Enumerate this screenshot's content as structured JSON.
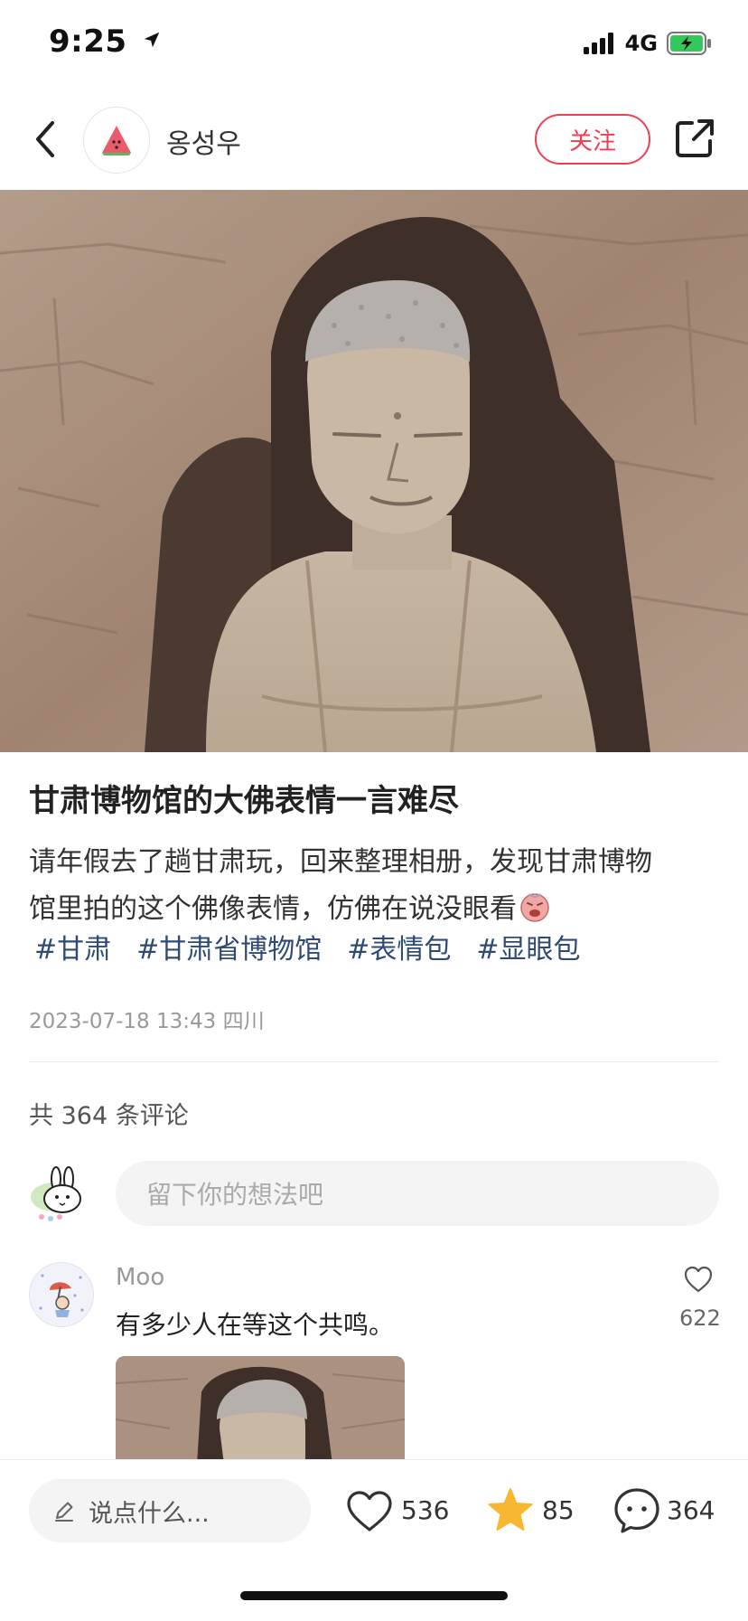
{
  "status_bar": {
    "time": "9:25",
    "network": "4G"
  },
  "header": {
    "username": "옹성우",
    "follow_label": "关注"
  },
  "post": {
    "title": "甘肃博物馆的大佛表情一言难尽",
    "body_line1": "请年假去了趟甘肃玩，回来整理相册，发现甘肃博物",
    "body_line2": "馆里拍的这个佛像表情，仿佛在说没眼看",
    "tags": [
      "#甘肃",
      "#甘肃省博物馆",
      "#表情包",
      "#显眼包"
    ],
    "meta": "2023-07-18 13:43 四川"
  },
  "comments": {
    "total_label": "共 364 条评论",
    "input_placeholder": "留下你的想法吧",
    "items": [
      {
        "author": "Moo",
        "text": "有多少人在等这个共鸣。",
        "likes": "622"
      }
    ]
  },
  "bottom_bar": {
    "input_placeholder": "说点什么...",
    "likes": "536",
    "favorites": "85",
    "comments": "364"
  },
  "colors": {
    "accent": "#ef3d53",
    "tag": "#2f4a77",
    "star": "#f7b731"
  },
  "icons": [
    "location-arrow-icon",
    "signal-icon",
    "battery-charging-icon",
    "back-chevron-icon",
    "watermelon-avatar-icon",
    "share-icon",
    "smiley-emoji-icon",
    "bunny-avatar-icon",
    "heart-icon",
    "pencil-icon",
    "star-icon",
    "comment-bubble-icon"
  ]
}
